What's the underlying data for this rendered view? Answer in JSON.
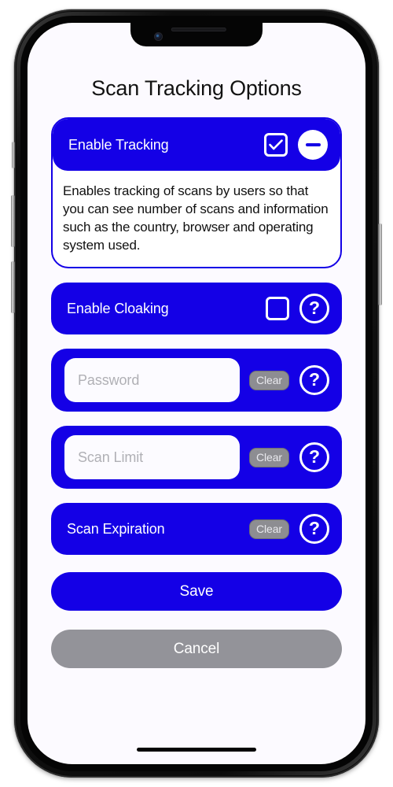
{
  "page": {
    "title": "Scan Tracking Options"
  },
  "tracking_card": {
    "label": "Enable Tracking",
    "checkbox_state": "checked",
    "checkbox_icon": "checkbox-checked-icon",
    "collapse_icon": "minus-circle-icon",
    "description": "Enables tracking of scans by users so that you can see number of scans and information such as the country, browser and operating system used."
  },
  "cloaking_row": {
    "label": "Enable Cloaking",
    "checkbox_state": "unchecked",
    "checkbox_icon": "checkbox-unchecked-icon",
    "help_icon": "question-circle-icon",
    "help_glyph": "?"
  },
  "password_row": {
    "placeholder": "Password",
    "value": "",
    "clear_label": "Clear",
    "help_icon": "question-circle-icon",
    "help_glyph": "?"
  },
  "scan_limit_row": {
    "placeholder": "Scan Limit",
    "value": "",
    "clear_label": "Clear",
    "help_icon": "question-circle-icon",
    "help_glyph": "?"
  },
  "scan_expiration_row": {
    "label": "Scan Expiration",
    "clear_label": "Clear",
    "help_icon": "question-circle-icon",
    "help_glyph": "?"
  },
  "actions": {
    "save_label": "Save",
    "cancel_label": "Cancel"
  },
  "colors": {
    "accent_blue": "#1400e6",
    "screen_background": "#fcfaff",
    "cancel_gray": "#939399",
    "clear_gray": "#8d8d92",
    "placeholder_gray": "#b0b0b5",
    "title_text": "#121212"
  }
}
